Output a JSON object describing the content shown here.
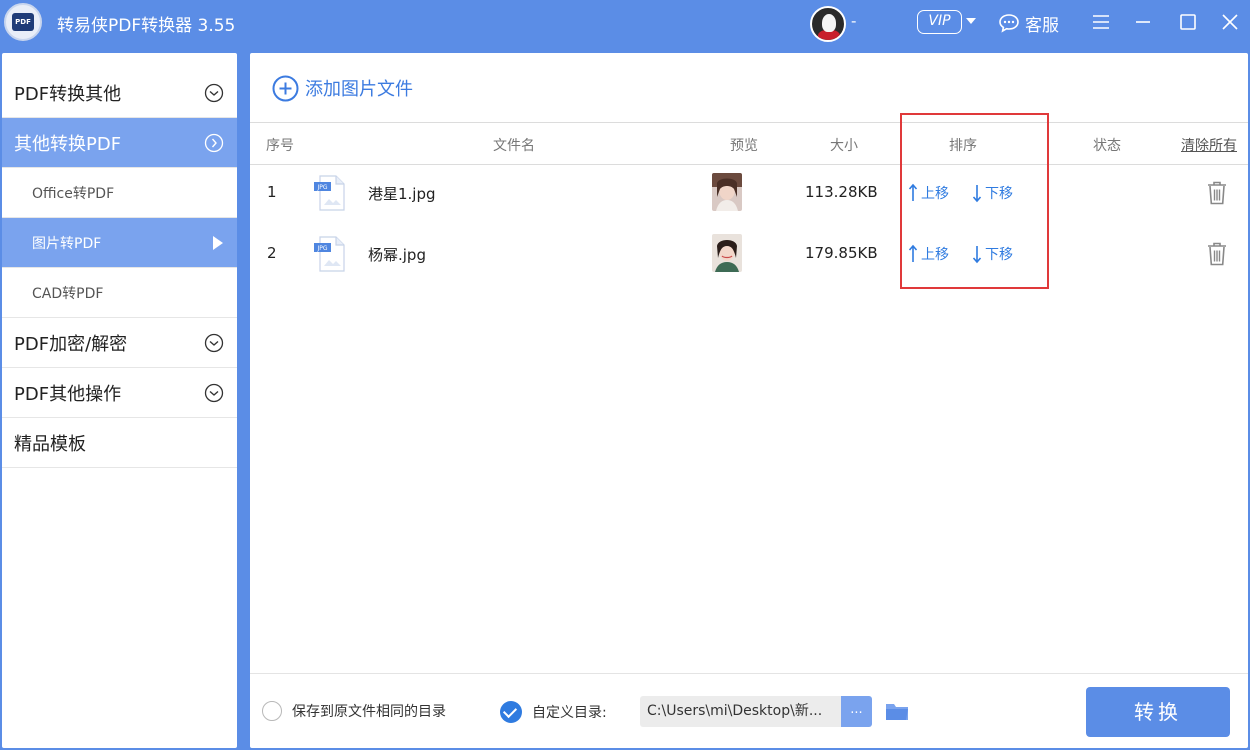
{
  "app": {
    "title": "转易侠PDF转换器 3.55",
    "logo_text": "PDF"
  },
  "header": {
    "user_name": "-",
    "vip_label": "VIP",
    "support_label": "客服"
  },
  "sidebar": {
    "items": [
      {
        "label": "PDF转换其他"
      },
      {
        "label": "其他转换PDF"
      },
      {
        "label": "Office转PDF"
      },
      {
        "label": "图片转PDF"
      },
      {
        "label": "CAD转PDF"
      },
      {
        "label": "PDF加密/解密"
      },
      {
        "label": "PDF其他操作"
      },
      {
        "label": "精品模板"
      }
    ]
  },
  "main": {
    "add_label": "添加图片文件",
    "columns": {
      "index": "序号",
      "filename": "文件名",
      "preview": "预览",
      "size": "大小",
      "order": "排序",
      "status": "状态",
      "clear_all": "清除所有"
    },
    "file_icon_label": "JPG",
    "move_up_label": "上移",
    "move_down_label": "下移",
    "rows": [
      {
        "index": "1",
        "filename": "港星1.jpg",
        "size": "113.28KB"
      },
      {
        "index": "2",
        "filename": "杨幂.jpg",
        "size": "179.85KB"
      }
    ]
  },
  "footer": {
    "same_dir_label": "保存到原文件相同的目录",
    "custom_dir_label": "自定义目录:",
    "path_value": "C:\\Users\\mi\\Desktop\\新...",
    "browse_label": "...",
    "convert_label": "转换"
  },
  "colors": {
    "accent": "#5b8de6",
    "active_nav": "#7aa3ee",
    "link": "#2f7be0",
    "highlight": "#e0393a"
  }
}
